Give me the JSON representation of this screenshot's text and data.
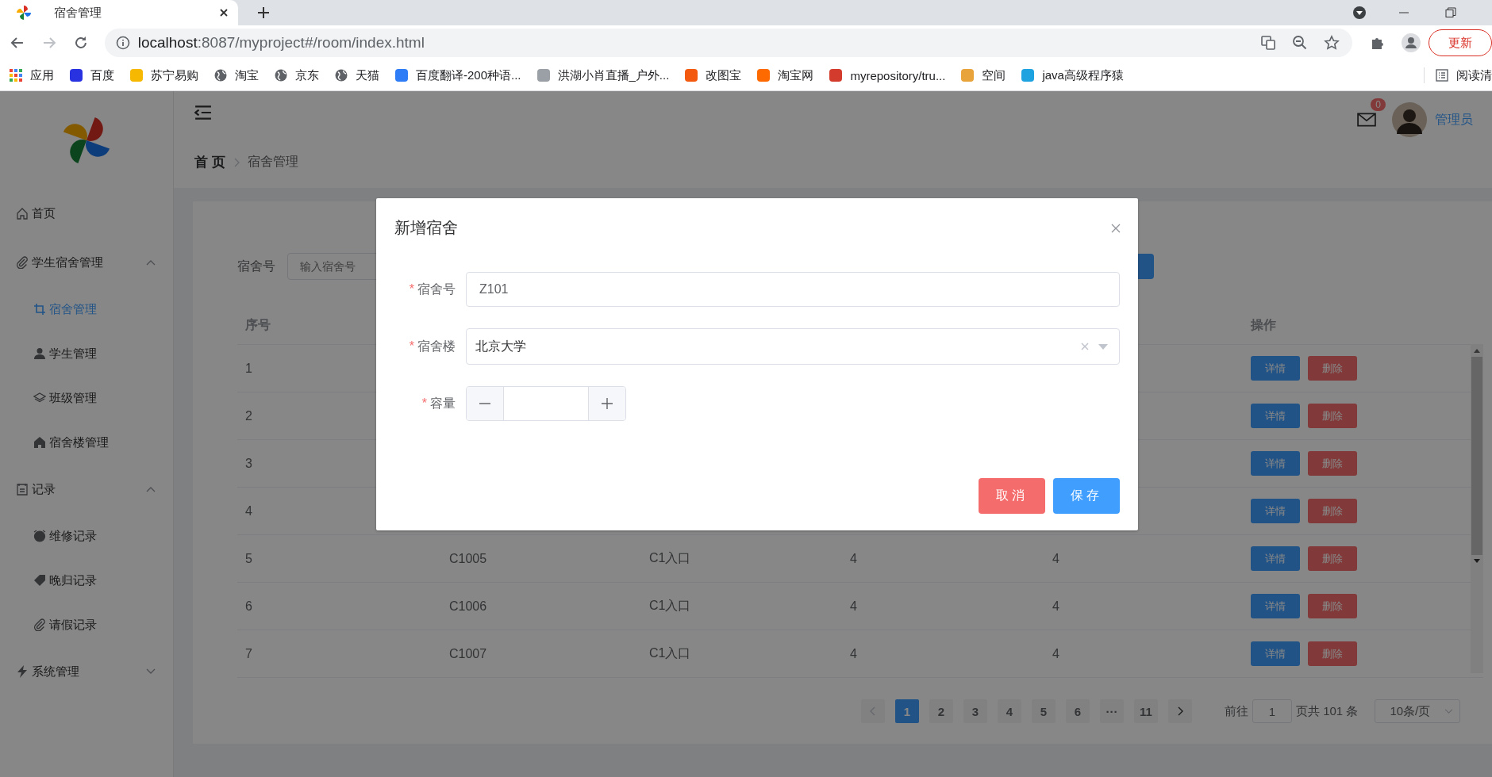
{
  "browser": {
    "tab_title": "宿舍管理",
    "url_host": "localhost",
    "url_rest": ":8087/myproject#/room/index.html",
    "update_button": "更新",
    "reading_list": "阅读清",
    "bookmarks": [
      {
        "label": "应用",
        "kind": "grid"
      },
      {
        "label": "百度",
        "kind": "logo",
        "color": "#2932e1"
      },
      {
        "label": "苏宁易购",
        "kind": "logo",
        "color": "#f6b800"
      },
      {
        "label": "淘宝",
        "kind": "globe"
      },
      {
        "label": "京东",
        "kind": "globe"
      },
      {
        "label": "天猫",
        "kind": "globe"
      },
      {
        "label": "百度翻译-200种语...",
        "kind": "logo",
        "color": "#2e7cf6"
      },
      {
        "label": "洪湖小肖直播_户外...",
        "kind": "logo",
        "color": "#9aa0a6"
      },
      {
        "label": "改图宝",
        "kind": "logo",
        "color": "#f45a0f"
      },
      {
        "label": "淘宝网",
        "kind": "logo",
        "color": "#ff6a00"
      },
      {
        "label": "myrepository/tru...",
        "kind": "logo",
        "color": "#d33b2c"
      },
      {
        "label": "空间",
        "kind": "logo",
        "color": "#e8a33b"
      },
      {
        "label": "java高级程序猿",
        "kind": "logo",
        "color": "#1fa3e0"
      }
    ]
  },
  "sidebar": {
    "items": [
      {
        "label": "首页",
        "kind": "home",
        "selected": false
      },
      {
        "label": "学生宿舍管理",
        "kind": "clip",
        "selected": false,
        "expanded": true,
        "children": [
          {
            "label": "宿舍管理",
            "kind": "crop",
            "selected": true
          },
          {
            "label": "学生管理",
            "kind": "user",
            "selected": false
          },
          {
            "label": "班级管理",
            "kind": "layers",
            "selected": false
          },
          {
            "label": "宿舍楼管理",
            "kind": "house",
            "selected": false
          }
        ]
      },
      {
        "label": "记录",
        "kind": "note",
        "selected": false,
        "expanded": true,
        "children": [
          {
            "label": "维修记录",
            "kind": "clock",
            "selected": false
          },
          {
            "label": "晚归记录",
            "kind": "tag",
            "selected": false
          },
          {
            "label": "请假记录",
            "kind": "clip",
            "selected": false
          }
        ]
      },
      {
        "label": "系统管理",
        "kind": "bolt",
        "selected": false,
        "expanded": false
      }
    ]
  },
  "header": {
    "notifications": "0",
    "user": "管理员",
    "breadcrumb": [
      "首 页",
      "宿舍管理"
    ]
  },
  "search": {
    "label": "宿舍号",
    "placeholder": "输入宿舍号"
  },
  "table": {
    "first_column": "序号",
    "last_column": "操作",
    "rows": [
      {
        "index": "1",
        "cells": [],
        "actions": [
          "详情",
          "删除"
        ]
      },
      {
        "index": "2",
        "cells": [],
        "actions": [
          "详情",
          "删除"
        ]
      },
      {
        "index": "3",
        "cells": [],
        "actions": [
          "详情",
          "删除"
        ]
      },
      {
        "index": "4",
        "cells": [],
        "actions": [
          "详情",
          "删除"
        ]
      },
      {
        "index": "5",
        "cells": [
          "C1005",
          "C1入口",
          "4",
          "4"
        ],
        "actions": [
          "详情",
          "删除"
        ]
      },
      {
        "index": "6",
        "cells": [
          "C1006",
          "C1入口",
          "4",
          "4"
        ],
        "actions": [
          "详情",
          "删除"
        ]
      },
      {
        "index": "7",
        "cells": [
          "C1007",
          "C1入口",
          "4",
          "4"
        ],
        "actions": [
          "详情",
          "删除"
        ]
      }
    ]
  },
  "pagination": {
    "pages": [
      {
        "label": "1",
        "selected": true
      },
      {
        "label": "2",
        "selected": false
      },
      {
        "label": "3",
        "selected": false
      },
      {
        "label": "4",
        "selected": false
      },
      {
        "label": "5",
        "selected": false
      },
      {
        "label": "6",
        "selected": false
      },
      {
        "label": "···",
        "selected": false
      },
      {
        "label": "11",
        "selected": false
      }
    ],
    "jump_label": "前往",
    "jump_value": "1",
    "total": "页共 101 条",
    "page_size": "10条/页"
  },
  "dialog": {
    "title": "新增宿舍",
    "fields": [
      {
        "kind": "text",
        "label": "宿舍号",
        "required_mark": "*",
        "value": "Z101"
      },
      {
        "kind": "select",
        "label": "宿舍楼",
        "required_mark": "*",
        "value": "北京大学"
      },
      {
        "kind": "number",
        "label": "容量",
        "required_mark": "*"
      }
    ],
    "buttons": [
      {
        "label": "取消",
        "kind": "danger"
      },
      {
        "label": "保存",
        "kind": "primary"
      }
    ]
  }
}
